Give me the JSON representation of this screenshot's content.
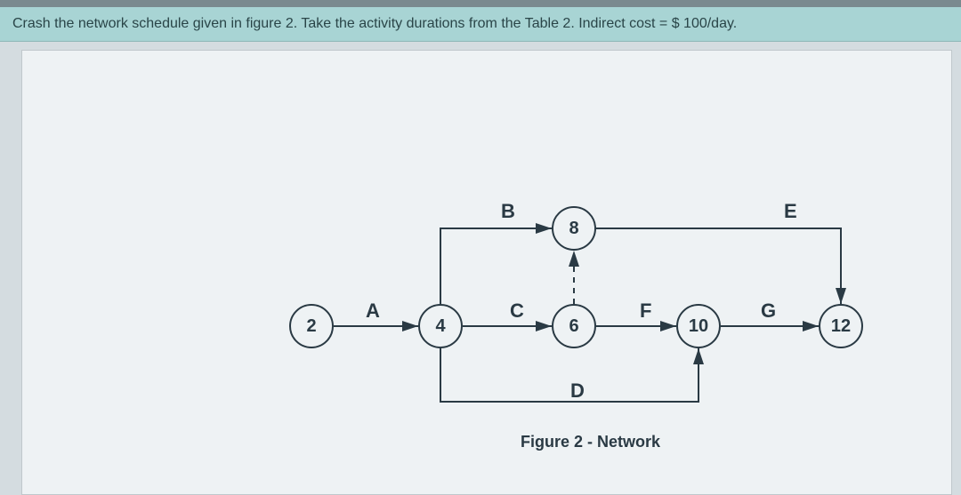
{
  "question_text": "Crash the network schedule given in figure 2. Take the activity durations from the Table 2. Indirect cost = $ 100/day.",
  "figure_caption": "Figure 2 -  Network",
  "nodes": {
    "n2": "2",
    "n4": "4",
    "n6": "6",
    "n8": "8",
    "n10": "10",
    "n12": "12"
  },
  "edges": {
    "A": "A",
    "B": "B",
    "C": "C",
    "D": "D",
    "E": "E",
    "F": "F",
    "G": "G"
  },
  "chart_data": {
    "type": "network-diagram",
    "title": "Figure 2 - Network",
    "nodes": [
      2,
      4,
      6,
      8,
      10,
      12
    ],
    "edges": [
      {
        "name": "A",
        "from": 2,
        "to": 4
      },
      {
        "name": "B",
        "from": 4,
        "to": 8
      },
      {
        "name": "C",
        "from": 4,
        "to": 6
      },
      {
        "name": "D",
        "from": 4,
        "to": 10
      },
      {
        "name": "E",
        "from": 8,
        "to": 12
      },
      {
        "name": "F",
        "from": 6,
        "to": 10
      },
      {
        "name": "G",
        "from": 10,
        "to": 12
      },
      {
        "name": "dummy",
        "from": 6,
        "to": 8,
        "dashed": true
      }
    ],
    "indirect_cost_per_day": 100,
    "currency": "$"
  }
}
